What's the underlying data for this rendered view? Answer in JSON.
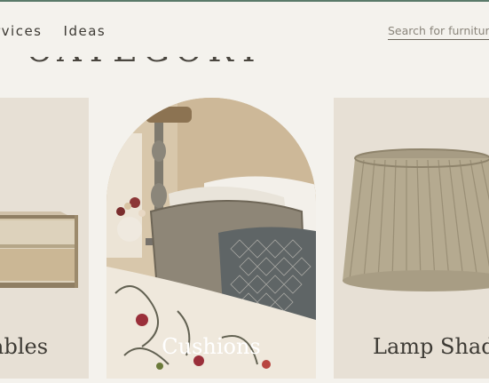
{
  "nav": {
    "items": [
      {
        "label": "rvices"
      },
      {
        "label": "Ideas"
      }
    ]
  },
  "search": {
    "placeholder": "Search for furnitur"
  },
  "section_title": "Y CATEGORY",
  "cards": [
    {
      "label": "Tables"
    },
    {
      "label": "Cushions"
    },
    {
      "label": "Lamp Shades"
    }
  ],
  "colors": {
    "background": "#f4f2ed",
    "card_background": "#e7e0d5",
    "accent_line": "#5a7a6a"
  }
}
